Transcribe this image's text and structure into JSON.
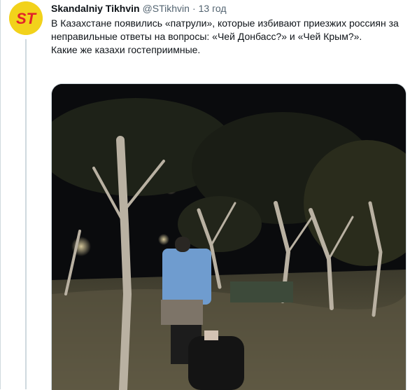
{
  "tweet": {
    "display_name": "Skandalniy Tikhvin",
    "handle": "@STikhvin",
    "separator": "·",
    "time": "13 год",
    "text_line1": "В Казахстане появились «патрули», которые избивают приезжих россиян за неправильные ответы на вопросы: «Чей Донбасс?» и «Чей Крым?».",
    "text_line2": "Какие же казахи гостеприимные.",
    "avatar": {
      "initials": "ST",
      "background": "#f2d21b",
      "text_color": "#e2222a"
    }
  },
  "media": {
    "type": "video-still",
    "scene": "night-park"
  },
  "colors": {
    "text": "#0f1419",
    "secondary": "#536471",
    "border": "#cfd9de"
  }
}
